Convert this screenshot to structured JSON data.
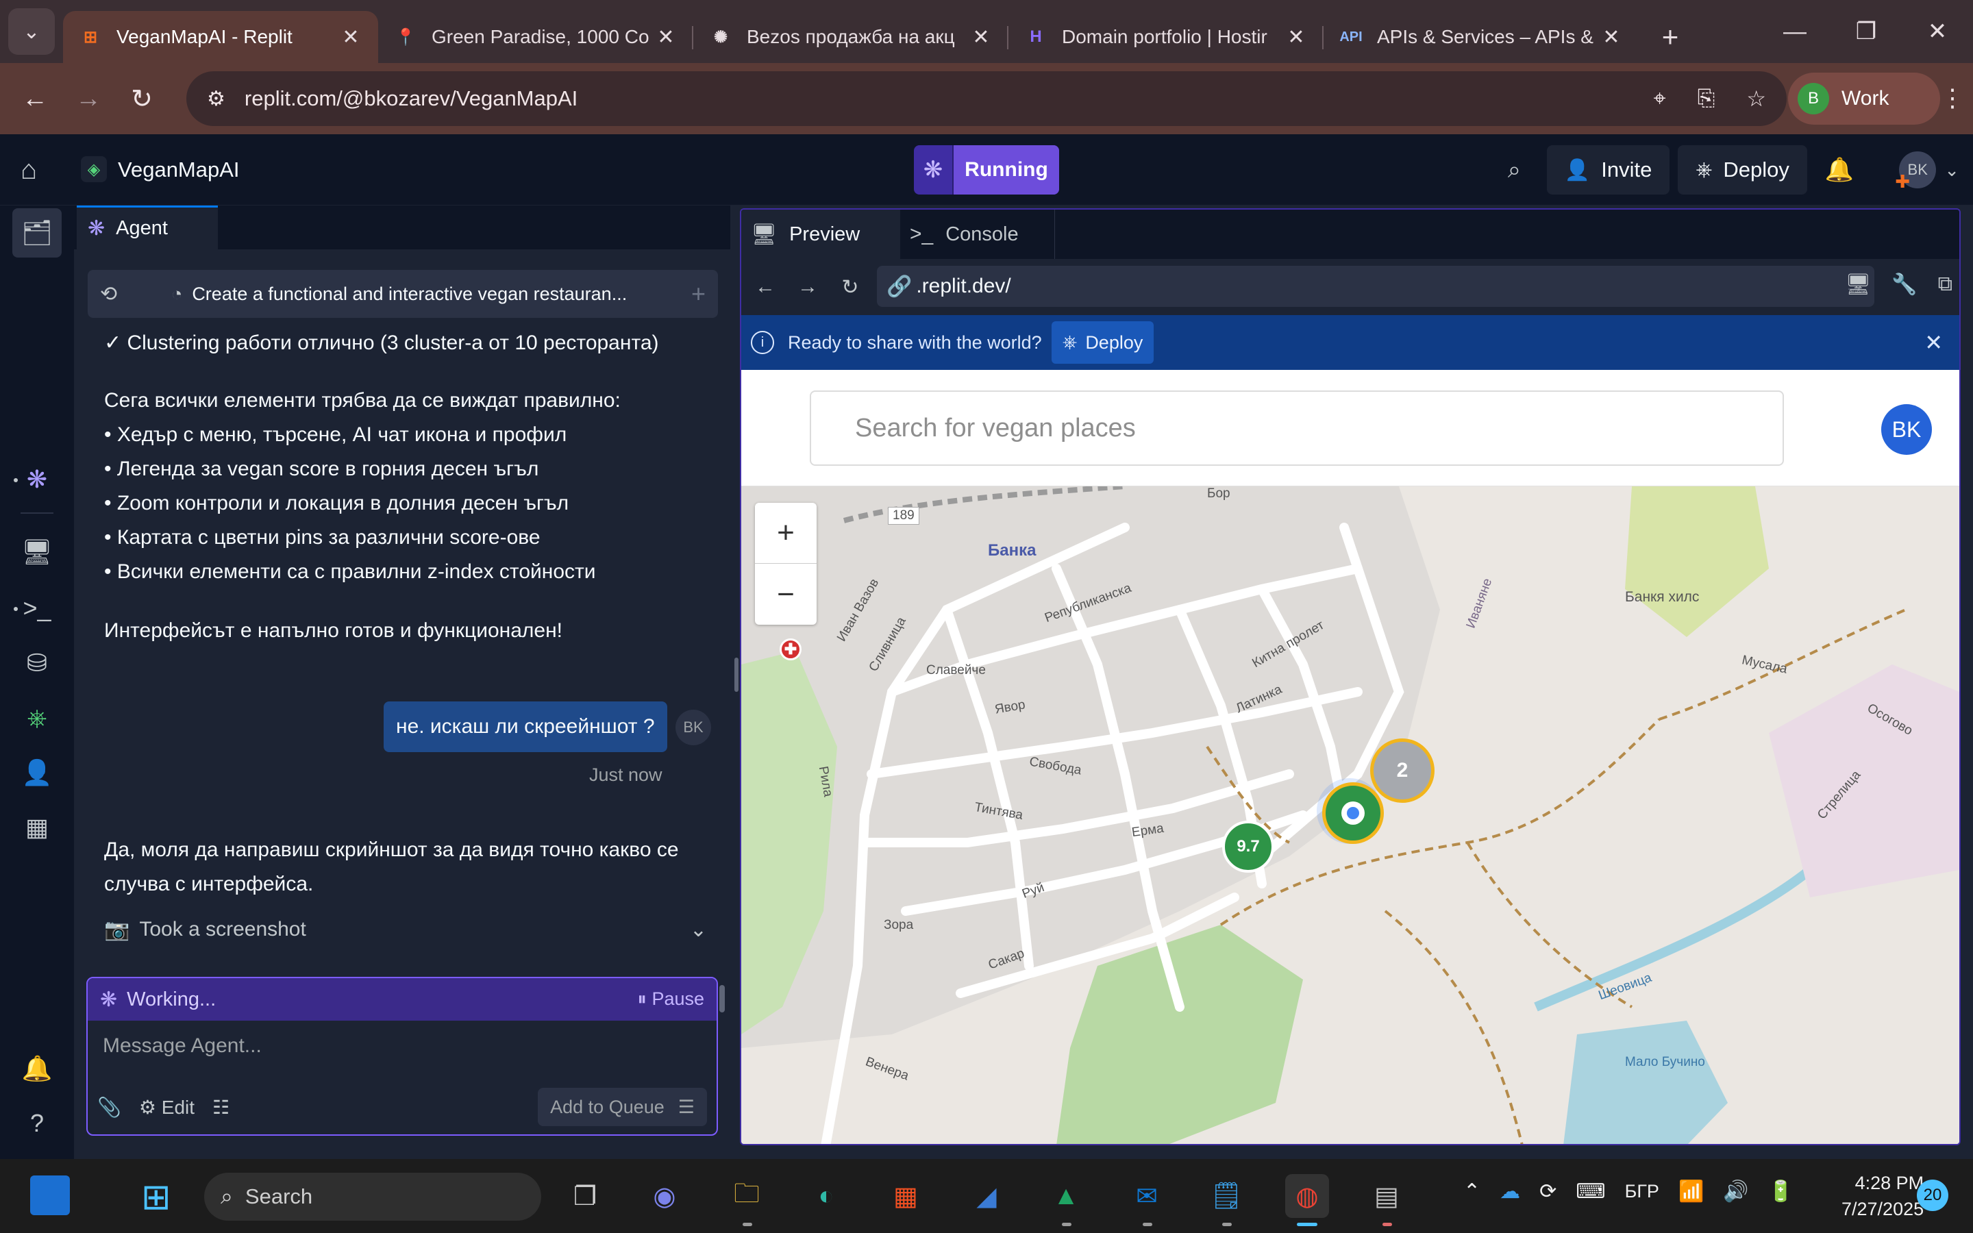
{
  "browser": {
    "tabs": [
      {
        "title": "VeganMapAI - Replit",
        "icon": "replit-icon",
        "active": true
      },
      {
        "title": "Green Paradise, 1000 Co",
        "icon": "maps-pin-icon",
        "active": false
      },
      {
        "title": "Bezos продажба на акц",
        "icon": "openai-icon",
        "active": false
      },
      {
        "title": "Domain portfolio | Hostir",
        "icon": "hostinger-icon",
        "active": false
      },
      {
        "title": "APIs & Services – APIs &",
        "icon": "api-icon",
        "active": false
      }
    ],
    "url": "replit.com/@bkozarev/VeganMapAI",
    "profile": {
      "initial": "B",
      "label": "Work"
    }
  },
  "replit": {
    "project_name": "VeganMapAI",
    "run_status": "Running",
    "invite_label": "Invite",
    "deploy_label": "Deploy",
    "user_initials": "BK"
  },
  "agent": {
    "tab_label": "Agent",
    "thread_title": "Create a functional and interactive vegan restauran...",
    "messages": {
      "line_cluster": "✓ Clustering работи отлично (3 cluster-а от 10 ресторанта)",
      "intro": "Сега всички елементи трябва да се виждат правилно:",
      "bullets": [
        "• Хедър с меню, търсене, AI чат икона и профил",
        "• Легенда за vegan score в горния десен ъгъл",
        "• Zoom контроли и локация в долния десен ъгъл",
        "• Картата с цветни pins за различни score-ове",
        "• Всички елементи са с правилни z-index стойности"
      ],
      "done": "Интерфейсът е напълно готов и функционален!",
      "user_message": "не. искаш ли скреейншот ?",
      "user_initials": "BK",
      "timestamp": "Just now",
      "agent_reply": "Да, моля да направиш скрийншот за да видя точно какво се случва с интерфейса.",
      "screenshot_action": "Took a screenshot"
    },
    "status": "Working...",
    "pause_label": "Pause",
    "input_placeholder": "Message Agent...",
    "edit_label": "Edit",
    "queue_label": "Add to Queue"
  },
  "preview": {
    "tab_preview": "Preview",
    "tab_console": "Console",
    "url": ".replit.dev/",
    "banner_text": "Ready to share with the world?",
    "banner_deploy": "Deploy",
    "search_placeholder": "Search for vegan places",
    "avatar_initials": "BK",
    "map": {
      "zoom_in": "+",
      "zoom_out": "−",
      "labels": {
        "road_number": "189",
        "banya": "Банка",
        "banya_hills": "Банкя хилс",
        "musala": "Мусала",
        "ivan_vazov": "Иван Вазов",
        "slivnitsa": "Сливница",
        "slaveyche": "Славейче",
        "yavor": "Явор",
        "svoboda": "Свобода",
        "respublikanska": "Републиканска",
        "erma": "Ерма",
        "tintyava": "Тинтява",
        "kitna_prolet": "Китна пролет",
        "latinka": "Латинка",
        "rila": "Рила",
        "sakar": "Сакар",
        "zora": "Зора",
        "ruy": "Руй",
        "venera": "Венера",
        "sheovitsa": "Шеовица",
        "malo_buchino": "Мало Бучино",
        "stralitsa": "Стрелица",
        "osogovo": "Осогово",
        "ivanyane": "Иваняне",
        "bor": "Бор"
      },
      "markers": [
        {
          "kind": "cluster",
          "label": "2",
          "color": "#a6a9ae",
          "ring": "#f2b51c"
        },
        {
          "kind": "restaurant",
          "label": "",
          "color": "#2e9447",
          "ring": "#f2b51c"
        },
        {
          "kind": "score",
          "label": "9.7",
          "color": "#2e9447",
          "ring": "#ffffff"
        }
      ]
    }
  },
  "taskbar": {
    "search_label": "Search",
    "language": "БГР",
    "time": "4:28 PM",
    "date": "7/27/2025",
    "notifications": "20"
  }
}
